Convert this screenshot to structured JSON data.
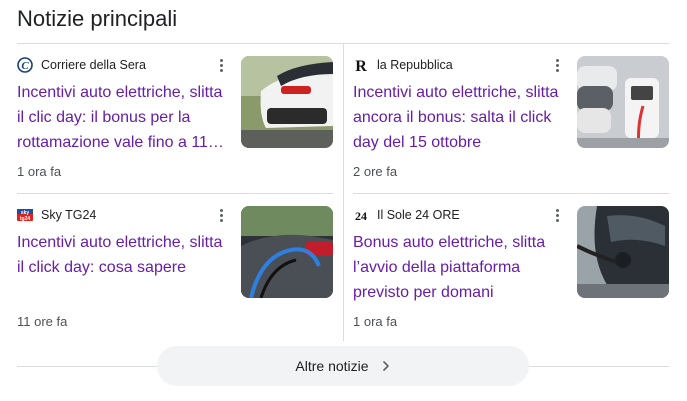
{
  "section": {
    "title": "Notizie principali"
  },
  "articles": [
    {
      "source": "Corriere della Sera",
      "logo_icon": "corriere-logo-icon",
      "headline": "Incentivi auto elettriche, slitta il clic day: il bonus per la rottamazione vale fino a 11…",
      "time": "1 ora fa",
      "thumb_icon": "white-car-rear-image"
    },
    {
      "source": "la Repubblica",
      "logo_icon": "repubblica-logo-icon",
      "headline": "Incentivi auto elettriche, slitta ancora il bonus: salta il click day del 15 ottobre",
      "time": "2 ore fa",
      "thumb_icon": "ev-charging-station-image"
    },
    {
      "source": "Sky TG24",
      "logo_icon": "skytg24-logo-icon",
      "headline": "Incentivi auto elettriche, slitta il click day: cosa sapere",
      "time": "11 ore fa",
      "thumb_icon": "car-charging-cable-image"
    },
    {
      "source": "Il Sole 24 ORE",
      "logo_icon": "sole24ore-logo-icon",
      "headline": "Bonus auto elettriche, slitta l’avvio della piattaforma previsto per domani",
      "time": "1 ora fa",
      "thumb_icon": "car-plugged-in-image"
    }
  ],
  "footer": {
    "more_label": "Altre notizie",
    "more_icon": "chevron-right-icon"
  },
  "colors": {
    "headline": "#681da8",
    "meta": "#4d5156",
    "divider": "#dadce0",
    "button_bg": "#f1f3f4"
  }
}
